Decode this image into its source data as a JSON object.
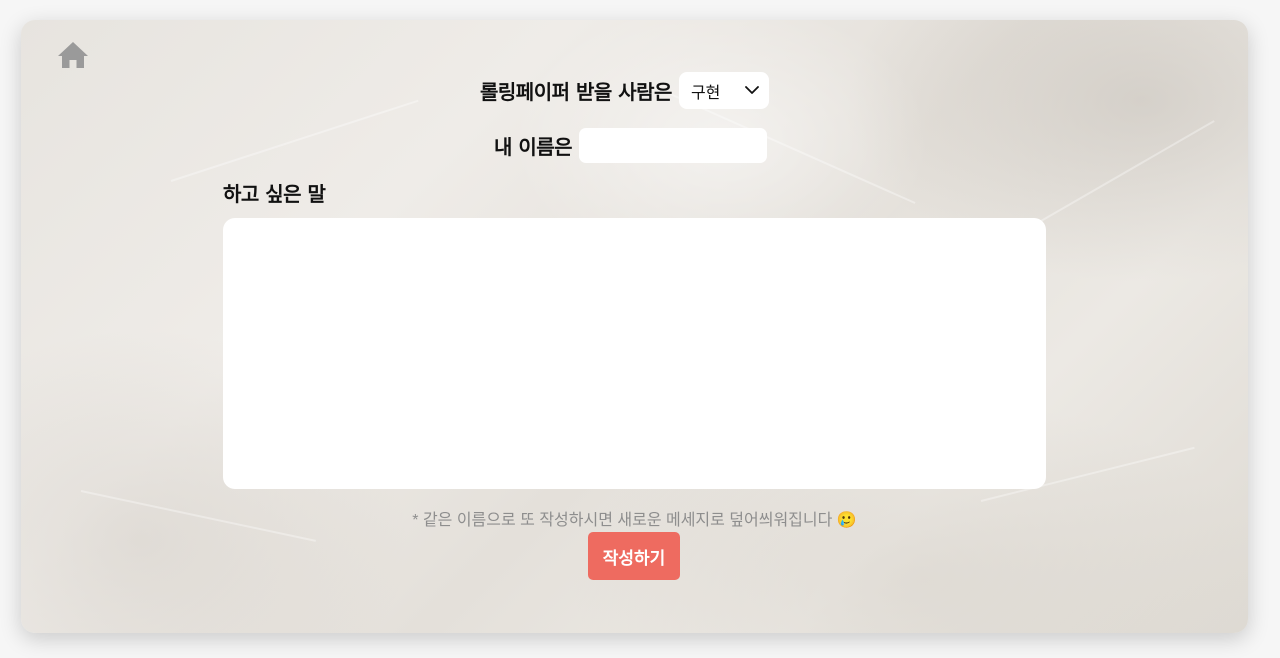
{
  "home": {
    "icon": "home-icon"
  },
  "recipient": {
    "label": "롤링페이퍼 받을 사람은",
    "selected": "구현",
    "chevron_icon": "chevron-down-icon"
  },
  "sender": {
    "label": "내 이름은",
    "value": "",
    "placeholder": ""
  },
  "message": {
    "label": "하고 싶은 말",
    "value": "",
    "placeholder": ""
  },
  "notice": "* 같은 이름으로 또 작성하시면 새로운 메세지로 덮어씌워집니다 🥲",
  "submit_label": "작성하기",
  "colors": {
    "accent": "#ee6b60",
    "notice_text": "#8e8e8e",
    "home_icon": "#9a9a9a"
  }
}
